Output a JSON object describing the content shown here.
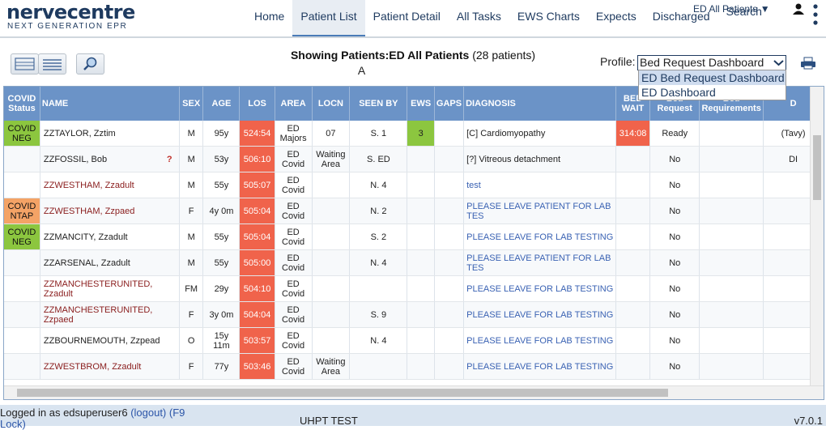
{
  "app": {
    "logo_main": "nervecentre",
    "logo_sub": "NEXT GENERATION EPR"
  },
  "nav": {
    "items": [
      {
        "label": "Home",
        "active": false
      },
      {
        "label": "Patient List",
        "active": true
      },
      {
        "label": "Patient Detail",
        "active": false
      },
      {
        "label": "All Tasks",
        "active": false
      },
      {
        "label": "EWS Charts",
        "active": false
      },
      {
        "label": "Expects",
        "active": false
      },
      {
        "label": "Discharged",
        "active": false
      },
      {
        "label": "Search",
        "active": false
      }
    ],
    "location": "ED All Patients ▼"
  },
  "toolbar": {
    "title_prefix": "Showing Patients:",
    "title_list": "ED All Patients",
    "title_count": "(28 patients)",
    "letter": "A",
    "profile_label": "Profile:",
    "profile_value": "Bed Request Dashboard",
    "profile_options": [
      "ED Bed Request Dashboard",
      "ED Dashboard"
    ]
  },
  "table": {
    "headers": [
      "COVID Status",
      "NAME",
      "SEX",
      "AGE",
      "LOS",
      "AREA",
      "LOCN",
      "SEEN BY",
      "EWS",
      "GAPS",
      "DIAGNOSIS",
      "BED WAIT",
      "Bed Request",
      "Bed Requirements",
      "D"
    ],
    "rows": [
      {
        "covid": "COVID NEG",
        "covid_type": "neg",
        "name": "ZZTAYLOR, Zztim",
        "name_red": false,
        "q": false,
        "sex": "M",
        "age": "95y",
        "los": "524:54",
        "area": "ED Majors",
        "locn": "07",
        "seen_by": "S. 1",
        "ews": "3",
        "gaps": "",
        "diagnosis": "[C] Cardiomyopathy",
        "diag_link": false,
        "bed_wait": "314:08",
        "bed_request": "Ready",
        "bed_req": "",
        "d": "(Tavy)"
      },
      {
        "covid": "",
        "covid_type": "",
        "name": "ZZFOSSIL, Bob",
        "name_red": false,
        "q": true,
        "sex": "M",
        "age": "53y",
        "los": "506:10",
        "area": "ED Covid",
        "locn": "Waiting Area",
        "seen_by": "S. ED",
        "ews": "",
        "gaps": "",
        "diagnosis": "[?] Vitreous detachment",
        "diag_link": false,
        "bed_wait": "",
        "bed_request": "No",
        "bed_req": "",
        "d": "DI"
      },
      {
        "covid": "",
        "covid_type": "",
        "name": "ZZWESTHAM, Zzadult",
        "name_red": true,
        "q": false,
        "sex": "M",
        "age": "55y",
        "los": "505:07",
        "area": "ED Covid",
        "locn": "",
        "seen_by": "N. 4",
        "ews": "",
        "gaps": "",
        "diagnosis": "test",
        "diag_link": true,
        "bed_wait": "",
        "bed_request": "No",
        "bed_req": "",
        "d": ""
      },
      {
        "covid": "COVID NTAP",
        "covid_type": "ntap",
        "name": "ZZWESTHAM, Zzpaed",
        "name_red": true,
        "q": false,
        "sex": "F",
        "age": "4y 0m",
        "los": "505:04",
        "area": "ED Covid",
        "locn": "",
        "seen_by": "N. 2",
        "ews": "",
        "gaps": "",
        "diagnosis": "PLEASE LEAVE PATIENT FOR LAB TES",
        "diag_link": true,
        "bed_wait": "",
        "bed_request": "No",
        "bed_req": "",
        "d": ""
      },
      {
        "covid": "COVID NEG",
        "covid_type": "neg",
        "name": "ZZMANCITY, Zzadult",
        "name_red": false,
        "q": false,
        "sex": "M",
        "age": "55y",
        "los": "505:04",
        "area": "ED Covid",
        "locn": "",
        "seen_by": "S. 2",
        "ews": "",
        "gaps": "",
        "diagnosis": "PLEASE LEAVE FOR LAB TESTING",
        "diag_link": true,
        "bed_wait": "",
        "bed_request": "No",
        "bed_req": "",
        "d": ""
      },
      {
        "covid": "",
        "covid_type": "",
        "name": "ZZARSENAL, Zzadult",
        "name_red": false,
        "q": false,
        "sex": "M",
        "age": "55y",
        "los": "505:00",
        "area": "ED Covid",
        "locn": "",
        "seen_by": "N. 4",
        "ews": "",
        "gaps": "",
        "diagnosis": "PLEASE LEAVE PATIENT FOR LAB TES",
        "diag_link": true,
        "bed_wait": "",
        "bed_request": "No",
        "bed_req": "",
        "d": ""
      },
      {
        "covid": "",
        "covid_type": "",
        "name": "ZZMANCHESTERUNITED, Zzadult",
        "name_red": true,
        "q": false,
        "sex": "FM",
        "age": "29y",
        "los": "504:10",
        "area": "ED Covid",
        "locn": "",
        "seen_by": "",
        "ews": "",
        "gaps": "",
        "diagnosis": "PLEASE LEAVE FOR LAB TESTING",
        "diag_link": true,
        "bed_wait": "",
        "bed_request": "No",
        "bed_req": "",
        "d": ""
      },
      {
        "covid": "",
        "covid_type": "",
        "name": "ZZMANCHESTERUNITED, Zzpaed",
        "name_red": true,
        "q": false,
        "sex": "F",
        "age": "3y 0m",
        "los": "504:04",
        "area": "ED Covid",
        "locn": "",
        "seen_by": "S. 9",
        "ews": "",
        "gaps": "",
        "diagnosis": "PLEASE LEAVE FOR LAB TESTING",
        "diag_link": true,
        "bed_wait": "",
        "bed_request": "No",
        "bed_req": "",
        "d": ""
      },
      {
        "covid": "",
        "covid_type": "",
        "name": "ZZBOURNEMOUTH, Zzpead",
        "name_red": false,
        "q": false,
        "sex": "O",
        "age": "15y 11m",
        "los": "503:57",
        "area": "ED Covid",
        "locn": "",
        "seen_by": "N. 4",
        "ews": "",
        "gaps": "",
        "diagnosis": "PLEASE LEAVE FOR LAB TESTING",
        "diag_link": true,
        "bed_wait": "",
        "bed_request": "No",
        "bed_req": "",
        "d": ""
      },
      {
        "covid": "",
        "covid_type": "",
        "name": "ZZWESTBROM, Zzadult",
        "name_red": true,
        "q": false,
        "sex": "F",
        "age": "77y",
        "los": "503:46",
        "area": "ED Covid",
        "locn": "Waiting Area",
        "seen_by": "",
        "ews": "",
        "gaps": "",
        "diagnosis": "PLEASE LEAVE FOR LAB TESTING",
        "diag_link": true,
        "bed_wait": "",
        "bed_request": "No",
        "bed_req": "",
        "d": ""
      }
    ]
  },
  "footer": {
    "logged_in": "Logged in as edsuperuser6",
    "logout": "(logout)",
    "lock": "(F9 Lock)",
    "center": "UHPT TEST",
    "version": "v7.0.1"
  },
  "colors": {
    "header_blue": "#6b93c7",
    "covid_neg": "#8cc63f",
    "covid_ntap": "#f4a366",
    "los_red": "#f0634b",
    "brand": "#1e3a5f"
  }
}
